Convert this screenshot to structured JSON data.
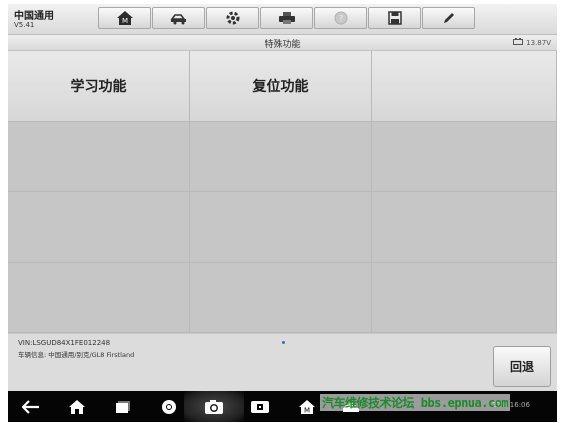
{
  "app": {
    "title": "中国通用",
    "version": "V5.41"
  },
  "page_title": "特殊功能",
  "battery": {
    "voltage": "13.87V"
  },
  "toolbar": [
    "home-icon",
    "car-icon",
    "gear-icon",
    "printer-icon",
    "help-icon",
    "save-icon",
    "pen-icon"
  ],
  "functions": [
    {
      "label": "学习功能"
    },
    {
      "label": "复位功能"
    }
  ],
  "vehicle_info": {
    "vin": "VIN:LSGUD84X1FE012248",
    "line": "车辆信息: 中国通用/别克/GL8 Firstland"
  },
  "back_button": "回退",
  "status": {
    "time": "27% 16:06"
  },
  "watermark": "汽车维修技术论坛 bbs.epnua.com"
}
